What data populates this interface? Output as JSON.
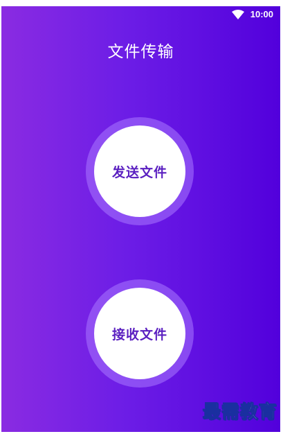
{
  "status_bar": {
    "time": "10:00",
    "wifi_icon": "wifi-icon"
  },
  "header": {
    "title": "文件传输"
  },
  "actions": {
    "send_label": "发送文件",
    "receive_label": "接收文件"
  },
  "watermark": {
    "text": "最需教育"
  },
  "colors": {
    "gradient_start": "#8a2be2",
    "gradient_end": "#5200dc",
    "button_text": "#5a1fc0",
    "ring": "#aa78ff"
  }
}
